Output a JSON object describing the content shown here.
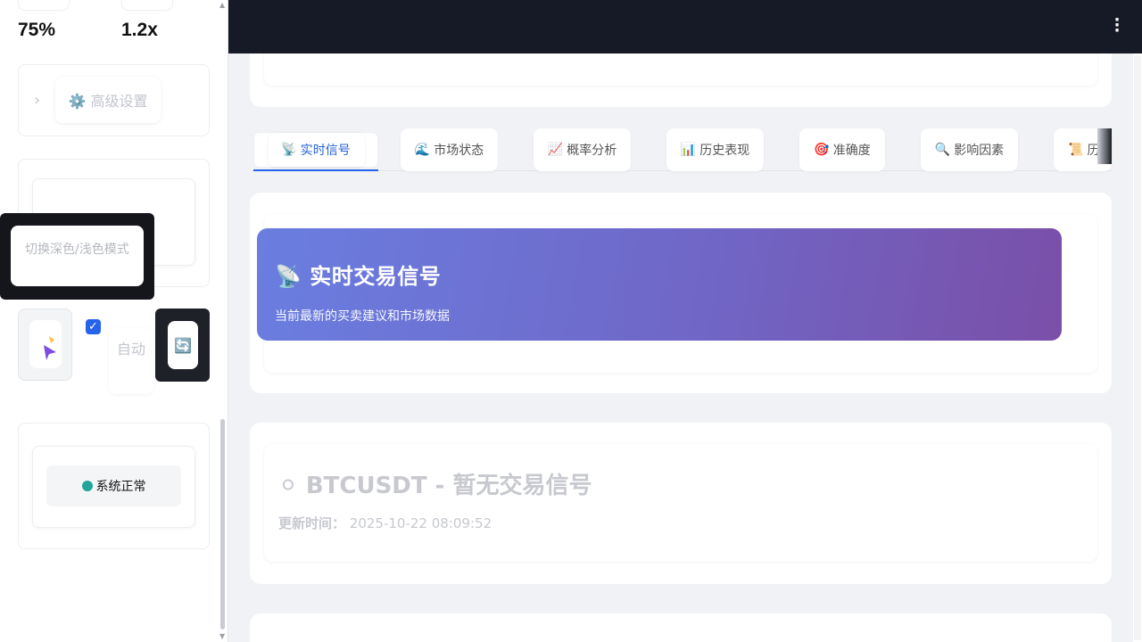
{
  "sidebar": {
    "metrics": [
      {
        "value": "75%"
      },
      {
        "value": "1.2x"
      }
    ],
    "advanced_settings": {
      "icon": "gear-icon",
      "label": "⚙️ 高级设置"
    },
    "tooltip_text": "切换深色/浅色模式",
    "auto_refresh": {
      "checked": true,
      "label": "自动"
    },
    "refresh_icon": "🔄",
    "status": {
      "label": "系统正常",
      "color": "#21a59a"
    }
  },
  "topbar": {
    "menu_icon": "⋮"
  },
  "tabs": [
    {
      "icon": "📡",
      "label": "实时信号",
      "active": true
    },
    {
      "icon": "🌊",
      "label": "市场状态"
    },
    {
      "icon": "📈",
      "label": "概率分析"
    },
    {
      "icon": "📊",
      "label": "历史表现"
    },
    {
      "icon": "🎯",
      "label": "准确度"
    },
    {
      "icon": "🔍",
      "label": "影响因素"
    },
    {
      "icon": "📜",
      "label": "历史"
    }
  ],
  "signal_banner": {
    "title": "📡 实时交易信号",
    "subtitle": "当前最新的买卖建议和市场数据"
  },
  "no_signal": {
    "title": "⚪ BTCUSDT - 暂无交易信号",
    "time_label": "更新时间：",
    "time_value": "2025-10-22 08:09:52"
  },
  "colors": {
    "accent": "#2563eb",
    "header_bg": "#161a26",
    "banner_start": "#6a7ee0",
    "banner_end": "#7a4fa8"
  }
}
